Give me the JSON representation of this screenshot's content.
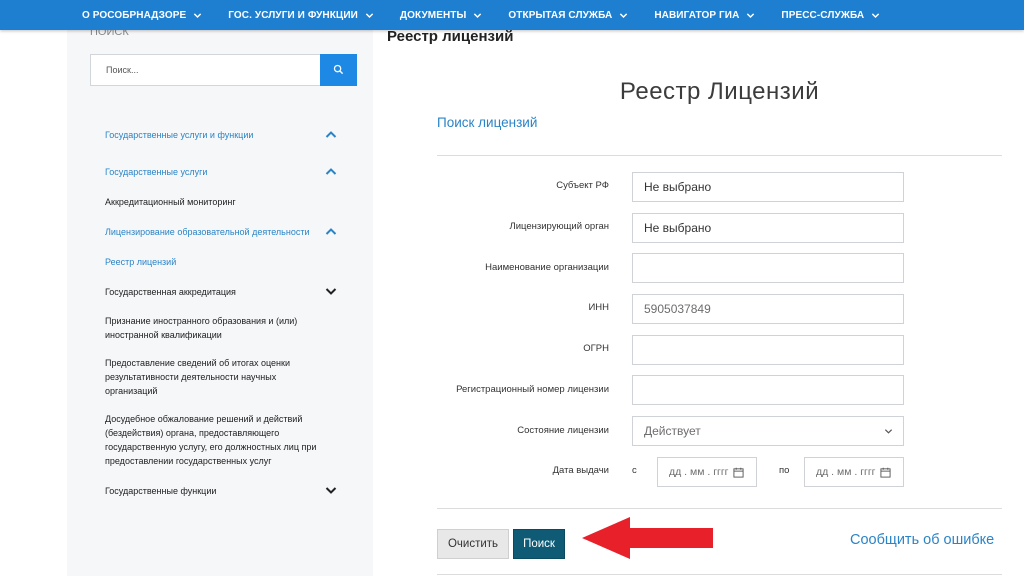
{
  "topnav": {
    "items": [
      {
        "label": "О РОСОБРНАДЗОРЕ"
      },
      {
        "label": "ГОС. УСЛУГИ И ФУНКЦИИ"
      },
      {
        "label": "ДОКУМЕНТЫ"
      },
      {
        "label": "ОТКРЫТАЯ СЛУЖБА"
      },
      {
        "label": "НАВИГАТОР ГИА"
      },
      {
        "label": "ПРЕСС-СЛУЖБА"
      }
    ]
  },
  "sidebar": {
    "heading": "ПОИСК",
    "search": {
      "placeholder": "Поиск...",
      "icon": "search-icon"
    },
    "items": [
      {
        "label": "Государственные услуги и функции",
        "toggle": "chevron-up-icon"
      },
      {
        "label": "Государственные услуги",
        "toggle": "chevron-up-icon"
      },
      {
        "label": "Аккредитационный мониторинг"
      },
      {
        "label": "Лицензирование образовательной деятельности",
        "toggle": "chevron-up-icon"
      },
      {
        "label": "Реестр лицензий"
      },
      {
        "label": "Государственная аккредитация",
        "toggle": "chevron-down-icon"
      },
      {
        "label": "Признание иностранного образования и (или) иностранной квалификации"
      },
      {
        "label": "Предоставление сведений об итогах оценки результативности деятельности научных организаций"
      },
      {
        "label": "Досудебное обжалование решений и действий (бездействия) органа, предоставляющего государственную услугу, его должностных лиц при предоставлении государственных услуг"
      },
      {
        "label": "Государственные функции",
        "toggle": "chevron-down-icon"
      }
    ]
  },
  "main": {
    "page_title": "Реестр лицензий",
    "registry_heading": "Реестр Лицензий",
    "tab": "Поиск лицензий",
    "form": {
      "subject_label": "Субъект РФ",
      "subject_value": "Не выбрано",
      "authority_label": "Лицензирующий орган",
      "authority_value": "Не выбрано",
      "org_name_label": "Наименование организации",
      "org_name_value": "",
      "inn_label": "ИНН",
      "inn_value": "5905037849",
      "ogrn_label": "ОГРН",
      "ogrn_value": "",
      "reg_number_label": "Регистрационный номер лицензии",
      "reg_number_value": "",
      "status_label": "Состояние лицензии",
      "status_value": "Действует",
      "date_label": "Дата выдачи",
      "date_from_label": "с",
      "date_to_label": "по",
      "date_from_placeholder": "дд . мм . гггг",
      "date_to_placeholder": "дд . мм . гггг"
    },
    "buttons": {
      "clear": "Очистить",
      "search": "Поиск"
    },
    "report_link": "Сообщить об ошибке"
  },
  "colors": {
    "nav_bg": "#1e7fd0",
    "link": "#2b84c6",
    "search_button": "#0f5b76",
    "arrow": "#e8202a"
  }
}
